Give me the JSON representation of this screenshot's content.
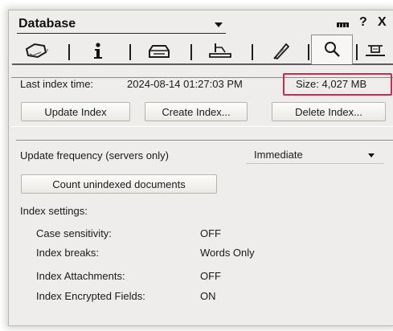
{
  "panel": {
    "title": "Database",
    "help_label": "?",
    "close_label": "X"
  },
  "tabs": [
    {
      "icon": "speech-bubble-icon"
    },
    {
      "icon": "info-icon"
    },
    {
      "icon": "printer-icon"
    },
    {
      "icon": "pen-icon"
    },
    {
      "icon": "feather-icon"
    },
    {
      "icon": "search-icon",
      "active": true
    },
    {
      "icon": "hat-icon"
    }
  ],
  "index_info": {
    "last_index_label": "Last index time:",
    "last_index_value": "2024-08-14 01:27:03 PM",
    "size_label": "Size: 4,027 MB",
    "highlight_color": "#cc2b4e"
  },
  "buttons": {
    "update_index": "Update Index",
    "create_index": "Create Index...",
    "delete_index": "Delete Index..."
  },
  "frequency": {
    "label": "Update frequency (servers only)",
    "selected": "Immediate"
  },
  "count_button": "Count unindexed documents",
  "settings": {
    "heading": "Index settings:",
    "rows": [
      {
        "label": "Case sensitivity:",
        "value": "OFF"
      },
      {
        "label": "Index breaks:",
        "value": "Words Only"
      },
      {
        "label": "Index Attachments:",
        "value": "OFF"
      },
      {
        "label": "Index Encrypted Fields:",
        "value": "ON"
      }
    ]
  }
}
